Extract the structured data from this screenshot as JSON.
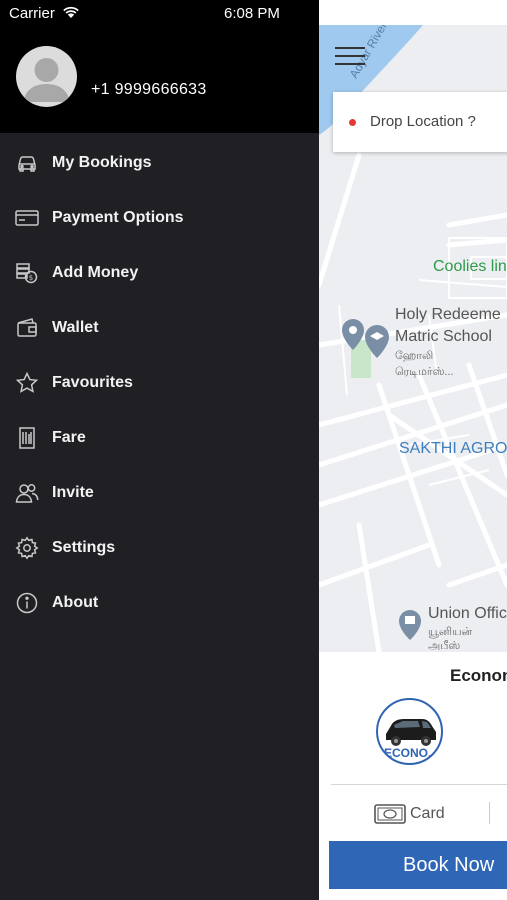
{
  "status_bar": {
    "carrier": "Carrier",
    "time": "6:08 PM"
  },
  "drawer": {
    "phone": "+1 9999666633",
    "menu": [
      {
        "label": "My Bookings",
        "icon": "car-icon"
      },
      {
        "label": "Payment Options",
        "icon": "credit-card-icon"
      },
      {
        "label": "Add Money",
        "icon": "money-icon"
      },
      {
        "label": "Wallet",
        "icon": "wallet-icon"
      },
      {
        "label": "Favourites",
        "icon": "star-icon"
      },
      {
        "label": "Fare",
        "icon": "receipt-icon"
      },
      {
        "label": "Invite",
        "icon": "users-icon"
      },
      {
        "label": "Settings",
        "icon": "gear-icon"
      },
      {
        "label": "About",
        "icon": "info-icon"
      }
    ]
  },
  "map": {
    "drop_location_placeholder": "Drop Location ?",
    "labels": {
      "river": "Adyar River",
      "coolies": "Coolies lin",
      "school_line1": "Holy Redeeme",
      "school_line2": "Matric School",
      "school_tamil1": "ஹோலி",
      "school_tamil2": "ரெடிமர்ஸ்...",
      "agro": "SAKTHI AGRO",
      "union": "Union Offic",
      "union_tamil1": "யூனியன்",
      "union_tamil2": "அபீஸ்"
    }
  },
  "booking_panel": {
    "vehicle_category": "Econon",
    "vehicle_badge": "ECONO..",
    "payment_method": "Card",
    "book_button": "Book Now"
  },
  "colors": {
    "drawer_bg": "#1f1f24",
    "header_bg": "#000000",
    "accent": "#2f66b6",
    "map_bg": "#eceef1",
    "river": "#9fc9ee",
    "poi_green": "#2e9b4a",
    "poi_blue": "#3f7fbf"
  }
}
